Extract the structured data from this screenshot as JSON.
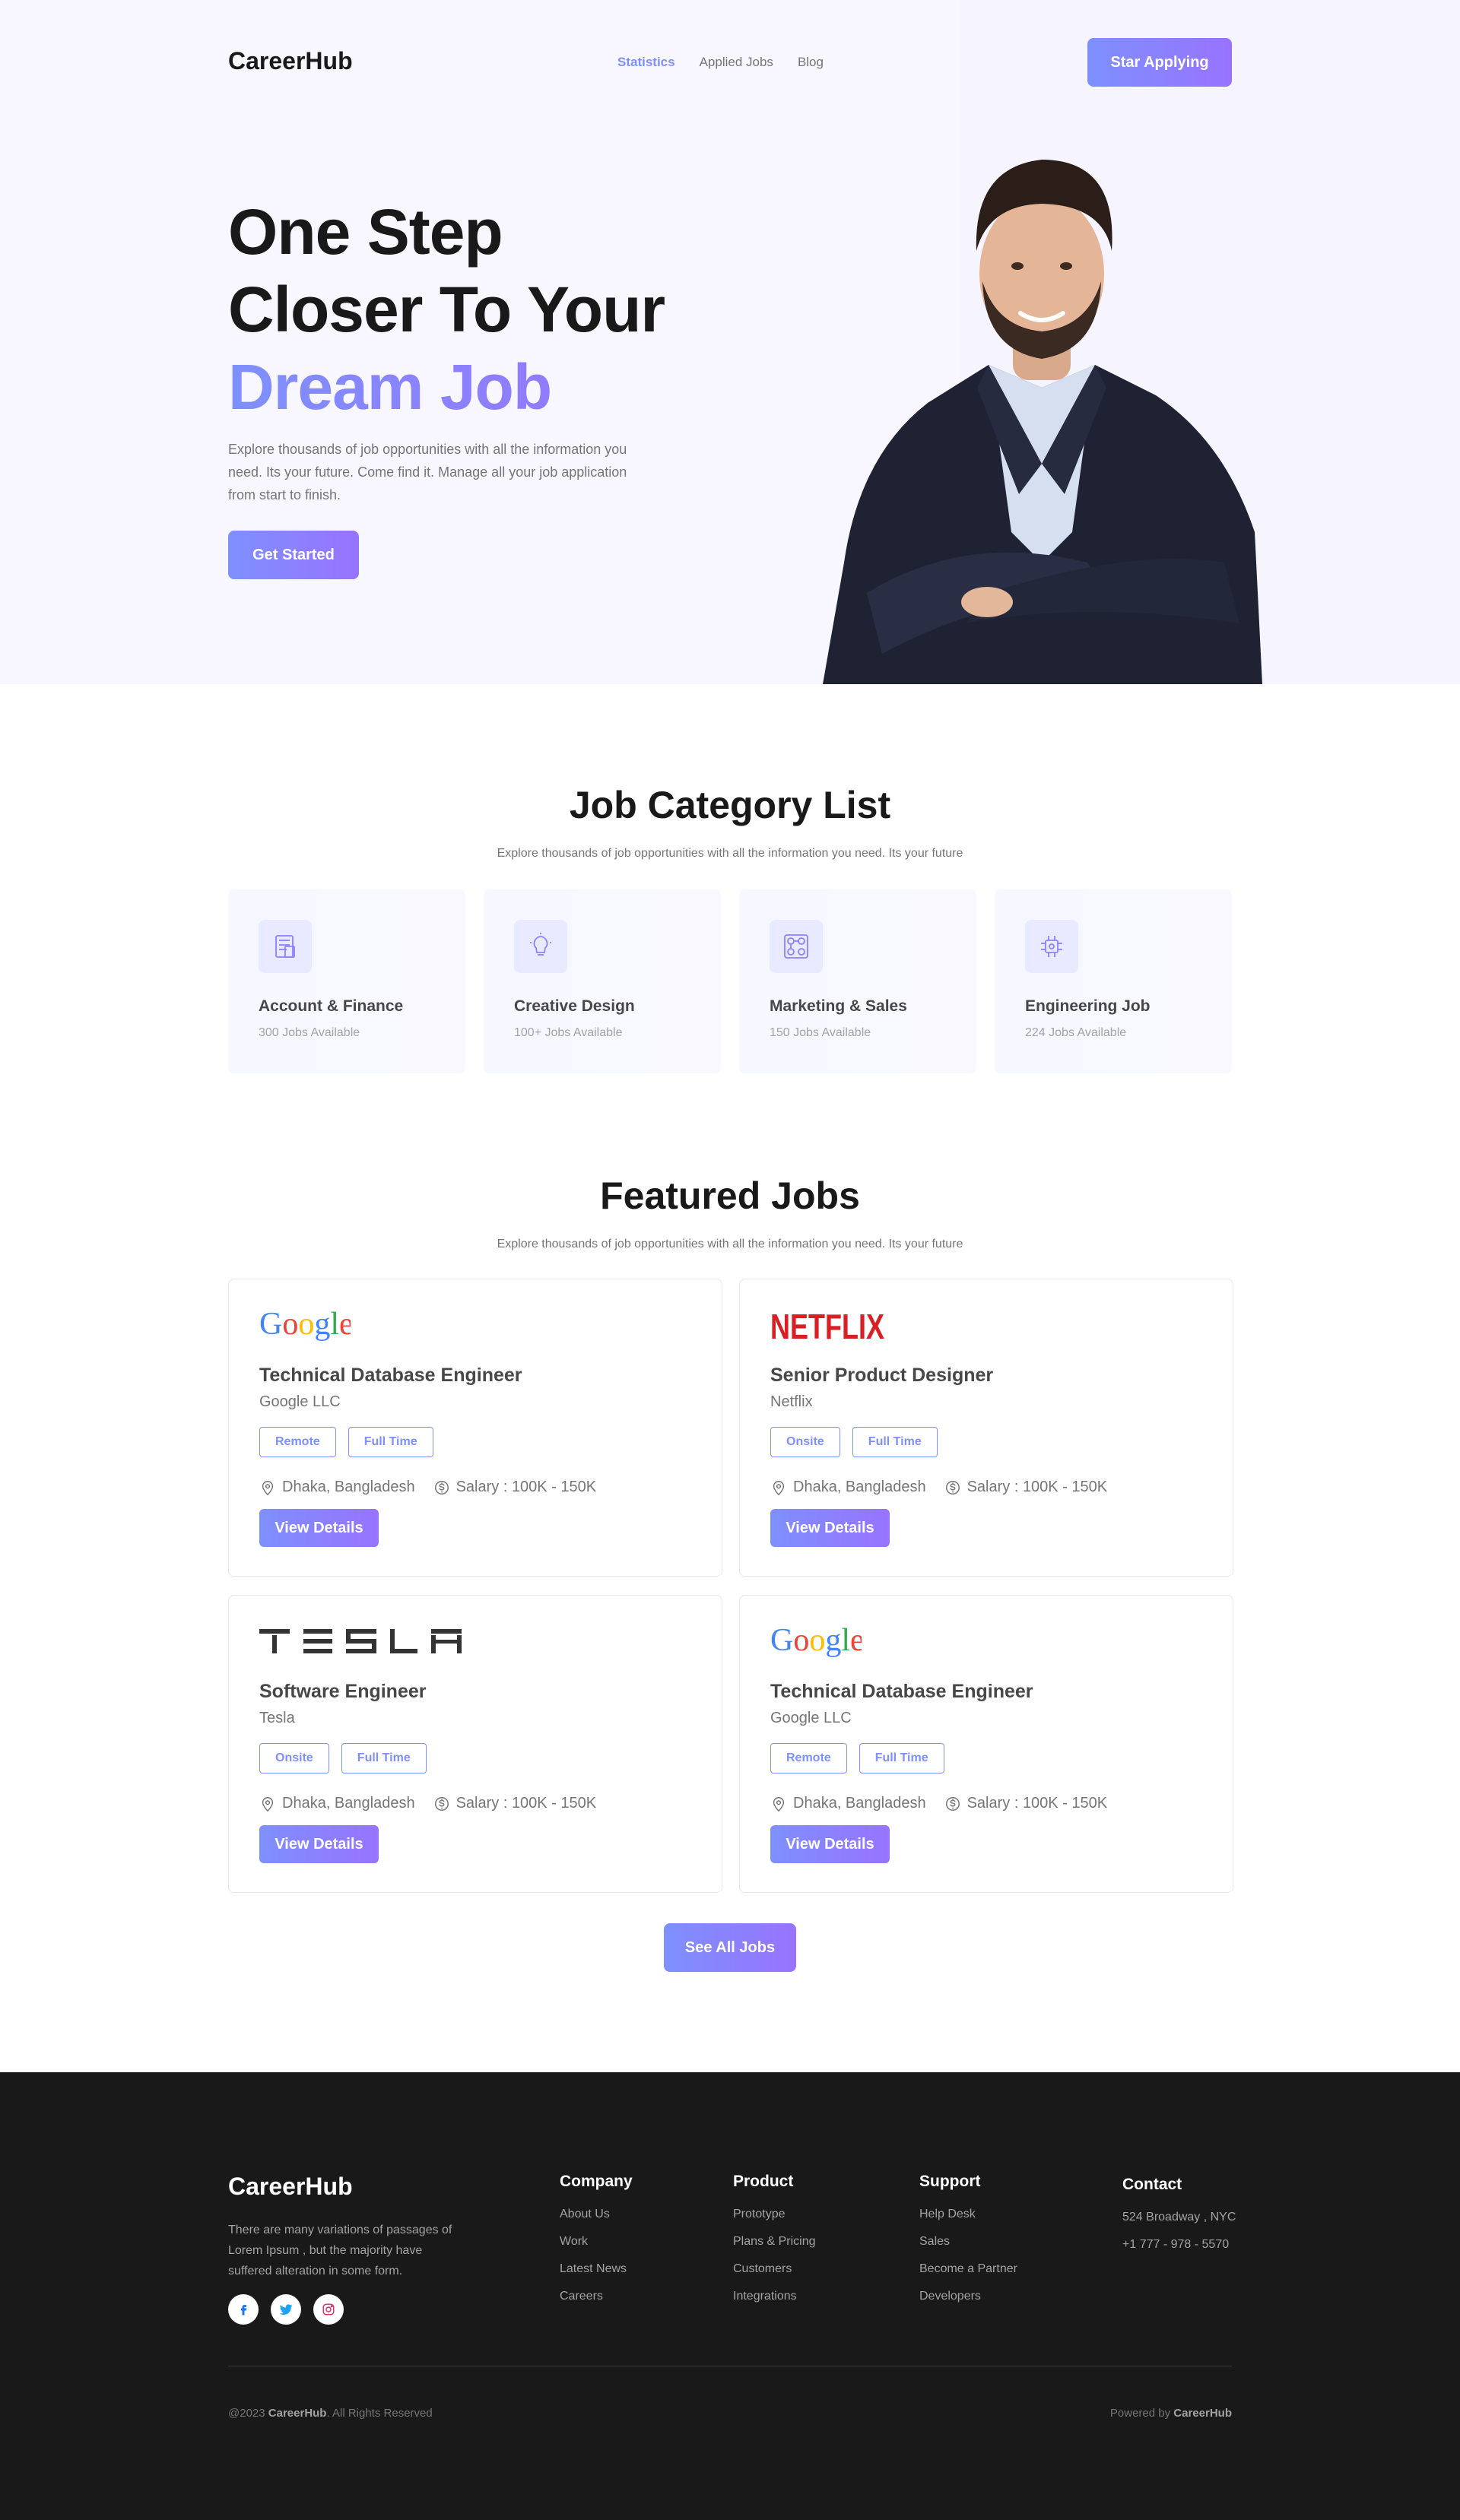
{
  "nav": {
    "logo": "CareerHub",
    "links": [
      "Statistics",
      "Applied Jobs",
      "Blog"
    ],
    "cta": "Star Applying"
  },
  "hero": {
    "title_line1": "One Step",
    "title_line2": "Closer To Your",
    "title_highlight": "Dream Job",
    "description": "Explore thousands of job opportunities with all the information you need. Its your future. Come find it. Manage all your job application from start to finish.",
    "button": "Get Started"
  },
  "categories": {
    "title": "Job Category List",
    "subtitle": "Explore thousands of job opportunities with all the information you need. Its your future",
    "items": [
      {
        "name": "Account & Finance",
        "count": "300 Jobs Available",
        "icon": "accounts-icon"
      },
      {
        "name": "Creative Design",
        "count": "100+ Jobs Available",
        "icon": "lightbulb-icon"
      },
      {
        "name": "Marketing & Sales",
        "count": "150 Jobs Available",
        "icon": "social-network-icon"
      },
      {
        "name": "Engineering Job",
        "count": "224 Jobs Available",
        "icon": "chip-icon"
      }
    ]
  },
  "featured": {
    "title": "Featured Jobs",
    "subtitle": "Explore thousands of job opportunities with all the information you need. Its your future",
    "jobs": [
      {
        "logo": "Google",
        "title": "Technical Database Engineer",
        "company": "Google LLC",
        "tags": [
          "Remote",
          "Full Time"
        ],
        "location": "Dhaka, Bangladesh",
        "salary": "Salary : 100K - 150K",
        "button": "View Details"
      },
      {
        "logo": "NETFLIX",
        "title": "Senior Product Designer",
        "company": "Netflix",
        "tags": [
          "Onsite",
          "Full Time"
        ],
        "location": "Dhaka, Bangladesh",
        "salary": "Salary : 100K - 150K",
        "button": "View Details"
      },
      {
        "logo": "TESLA",
        "title": "Software Engineer",
        "company": "Tesla",
        "tags": [
          "Onsite",
          "Full Time"
        ],
        "location": "Dhaka, Bangladesh",
        "salary": "Salary : 100K - 150K",
        "button": "View Details"
      },
      {
        "logo": "Google",
        "title": "Technical Database Engineer",
        "company": "Google LLC",
        "tags": [
          "Remote",
          "Full Time"
        ],
        "location": "Dhaka, Bangladesh",
        "salary": "Salary : 100K - 150K",
        "button": "View Details"
      }
    ],
    "see_all": "See All Jobs"
  },
  "footer": {
    "logo": "CareerHub",
    "description": "There are many variations of passages of Lorem Ipsum , but the majority have suffered alteration in some form.",
    "columns": [
      {
        "title": "Company",
        "links": [
          "About Us",
          "Work",
          "Latest News",
          "Careers"
        ]
      },
      {
        "title": "Product",
        "links": [
          "Prototype",
          "Plans & Pricing",
          "Customers",
          "Integrations"
        ]
      },
      {
        "title": "Support",
        "links": [
          "Help Desk",
          "Sales",
          "Become a Partner",
          "Developers"
        ]
      },
      {
        "title": "Contact",
        "links": [
          "524 Broadway , NYC",
          "+1 777 - 978 - 5570"
        ]
      }
    ],
    "copyright_prefix": "@2023",
    "copyright_brand": "CareerHub",
    "copyright_suffix": ". All Rights Reserved",
    "powered_prefix": "Powered by",
    "powered_brand": "CareerHub"
  },
  "colors": {
    "accent_start": "#7E90FE",
    "accent_end": "#9873FF",
    "footer_bg": "#1A1919",
    "netflix_red": "#D81F26"
  }
}
